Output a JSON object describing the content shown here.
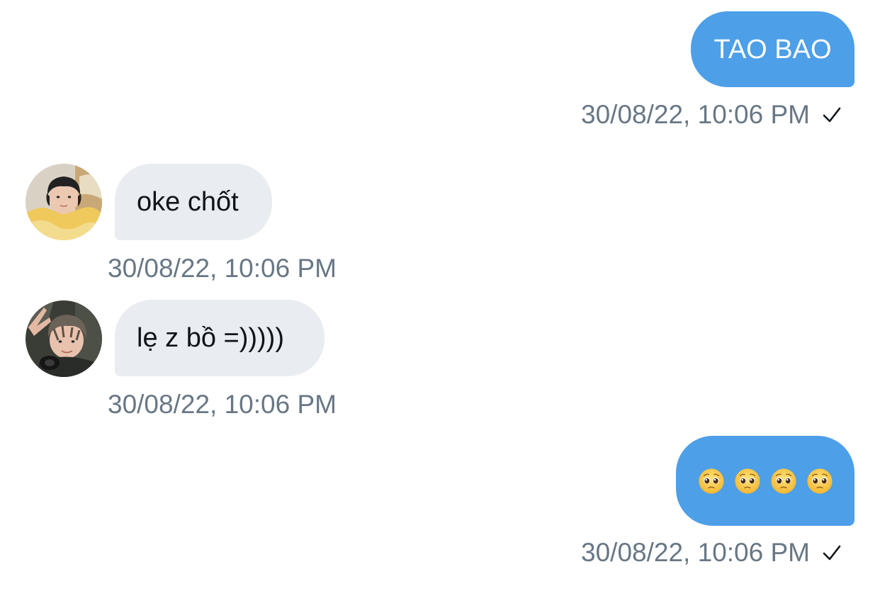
{
  "messages": [
    {
      "direction": "outgoing",
      "text": "TAO BAO",
      "timestamp": "30/08/22, 10:06 PM",
      "status": "sent"
    },
    {
      "direction": "incoming",
      "text": "oke chốt",
      "timestamp": "30/08/22, 10:06 PM",
      "avatar": "user-avatar-1"
    },
    {
      "direction": "incoming",
      "text": "lẹ z bồ =)))))",
      "timestamp": "30/08/22, 10:06 PM",
      "avatar": "user-avatar-2"
    },
    {
      "direction": "outgoing",
      "emojis": [
        "pleading-face",
        "pleading-face",
        "pleading-face",
        "pleading-face"
      ],
      "timestamp": "30/08/22, 10:06 PM",
      "status": "sent"
    }
  ],
  "icons": {
    "status": "checkmark-icon"
  },
  "colors": {
    "outgoing_bubble": "#4d9fe8",
    "incoming_bubble": "#e9ecf0",
    "timestamp_text": "#687785",
    "incoming_text": "#0f1419",
    "outgoing_text": "#ffffff"
  }
}
